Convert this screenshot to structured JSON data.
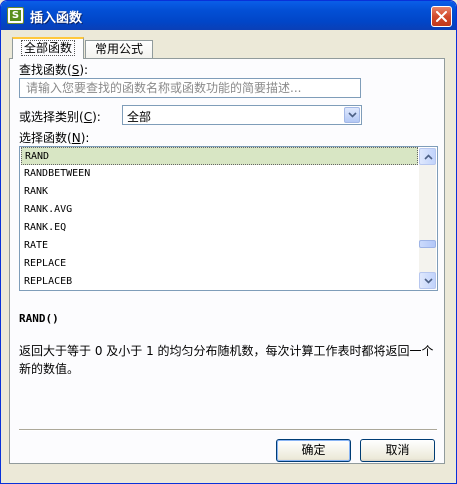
{
  "window": {
    "title": "插入函数",
    "app_icon_glyph": "S",
    "accent_color": "#0146c8"
  },
  "tabs": [
    {
      "label": "全部函数",
      "active": true
    },
    {
      "label": "常用公式",
      "active": false
    }
  ],
  "search": {
    "label": "查找函数",
    "hotkey": "S",
    "placeholder": "请输入您要查找的函数名称或函数功能的简要描述..."
  },
  "category": {
    "label": "或选择类别",
    "hotkey": "C",
    "selected": "全部"
  },
  "function_list": {
    "label": "选择函数",
    "hotkey": "N",
    "items": [
      "RAND",
      "RANDBETWEEN",
      "RANK",
      "RANK.AVG",
      "RANK.EQ",
      "RATE",
      "REPLACE",
      "REPLACEB"
    ],
    "selected_index": 0
  },
  "details": {
    "signature": "RAND()",
    "description": "返回大于等于 0 及小于 1 的均匀分布随机数，每次计算工作表时都将返回一个新的数值。"
  },
  "buttons": {
    "ok": "确定",
    "cancel": "取消"
  }
}
